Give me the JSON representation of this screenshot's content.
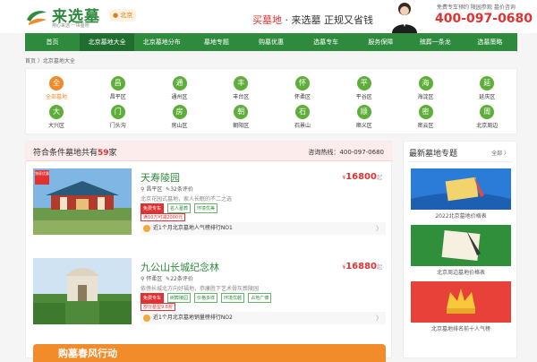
{
  "header": {
    "logo_text": "来选墓",
    "logo_sub": "用心来选 一块墓地",
    "city": "北京",
    "slogan": [
      "买墓地",
      " · ",
      "来选墓",
      " 正规又省钱"
    ],
    "hotline_small": "免费专车预约 陵园参观 墓价咨询",
    "hotline": "400-097-0680"
  },
  "nav": {
    "items": [
      "首页",
      "北京墓地大全",
      "北京墓地分布",
      "墓地专题",
      "购墓优惠",
      "选墓专车",
      "服务保障",
      "殡葬一条龙",
      "选墓策略"
    ],
    "active": 1
  },
  "breadcrumb": "首页 〉北京墓地大全",
  "districts": [
    {
      "char": "全",
      "label": "全部墓地",
      "highlight": true
    },
    {
      "char": "昌",
      "label": "昌平区"
    },
    {
      "char": "通",
      "label": "通州区"
    },
    {
      "char": "丰",
      "label": "丰台区"
    },
    {
      "char": "怀",
      "label": "怀柔区"
    },
    {
      "char": "平",
      "label": "平谷区"
    },
    {
      "char": "海",
      "label": "海淀区"
    },
    {
      "char": "延",
      "label": "延庆区"
    },
    {
      "char": "大",
      "label": "大兴区"
    },
    {
      "char": "门",
      "label": "门头沟"
    },
    {
      "char": "房",
      "label": "房山区"
    },
    {
      "char": "朝",
      "label": "朝阳区"
    },
    {
      "char": "石",
      "label": "石景山"
    },
    {
      "char": "顺",
      "label": "顺义区"
    },
    {
      "char": "密",
      "label": "密云区"
    },
    {
      "char": "周",
      "label": "北京周边"
    }
  ],
  "results": {
    "title_pre": "符合条件墓地共有",
    "count": "59",
    "title_post": "家",
    "hotline": "咨询热线：400-097-0680"
  },
  "cards": [
    {
      "name": "天寿陵园",
      "exclusive": "独家优惠",
      "price": "16800",
      "district": "昌平区",
      "reviews": "32条评价",
      "desc": "北京花园式墓地，家人长眠的不二之选",
      "tags": [
        "免费专车",
        "名人墓葬",
        "环境优美"
      ],
      "deal": "满10万可减2000元",
      "rank": "近1个月北京墓地人气榜排行NO1"
    },
    {
      "name": "九公山长城纪念林",
      "price": "16880",
      "district": "怀柔区",
      "reviews": "22条评价",
      "desc": "依傍长城北方向好福地，恭康胜下艺术骨灰葬陵园",
      "tags": [
        "免费专车",
        "树葬陵园",
        "价格多样",
        "环境优越",
        "占地广博"
      ],
      "deal": "部分墓型9.8折",
      "rank": "近1个月北京墓地销量榜排行NO2"
    }
  ],
  "price_unit": "起",
  "yen": "¥",
  "promo": "购墓春风行动",
  "sidebar": {
    "title": "最新墓地专题",
    "all": "全部 〉",
    "items": [
      {
        "caption": "2022北京墓地价格表"
      },
      {
        "caption": "北京周边墓地价格表"
      },
      {
        "caption": "北京墓地排名前十人气榜"
      }
    ]
  }
}
